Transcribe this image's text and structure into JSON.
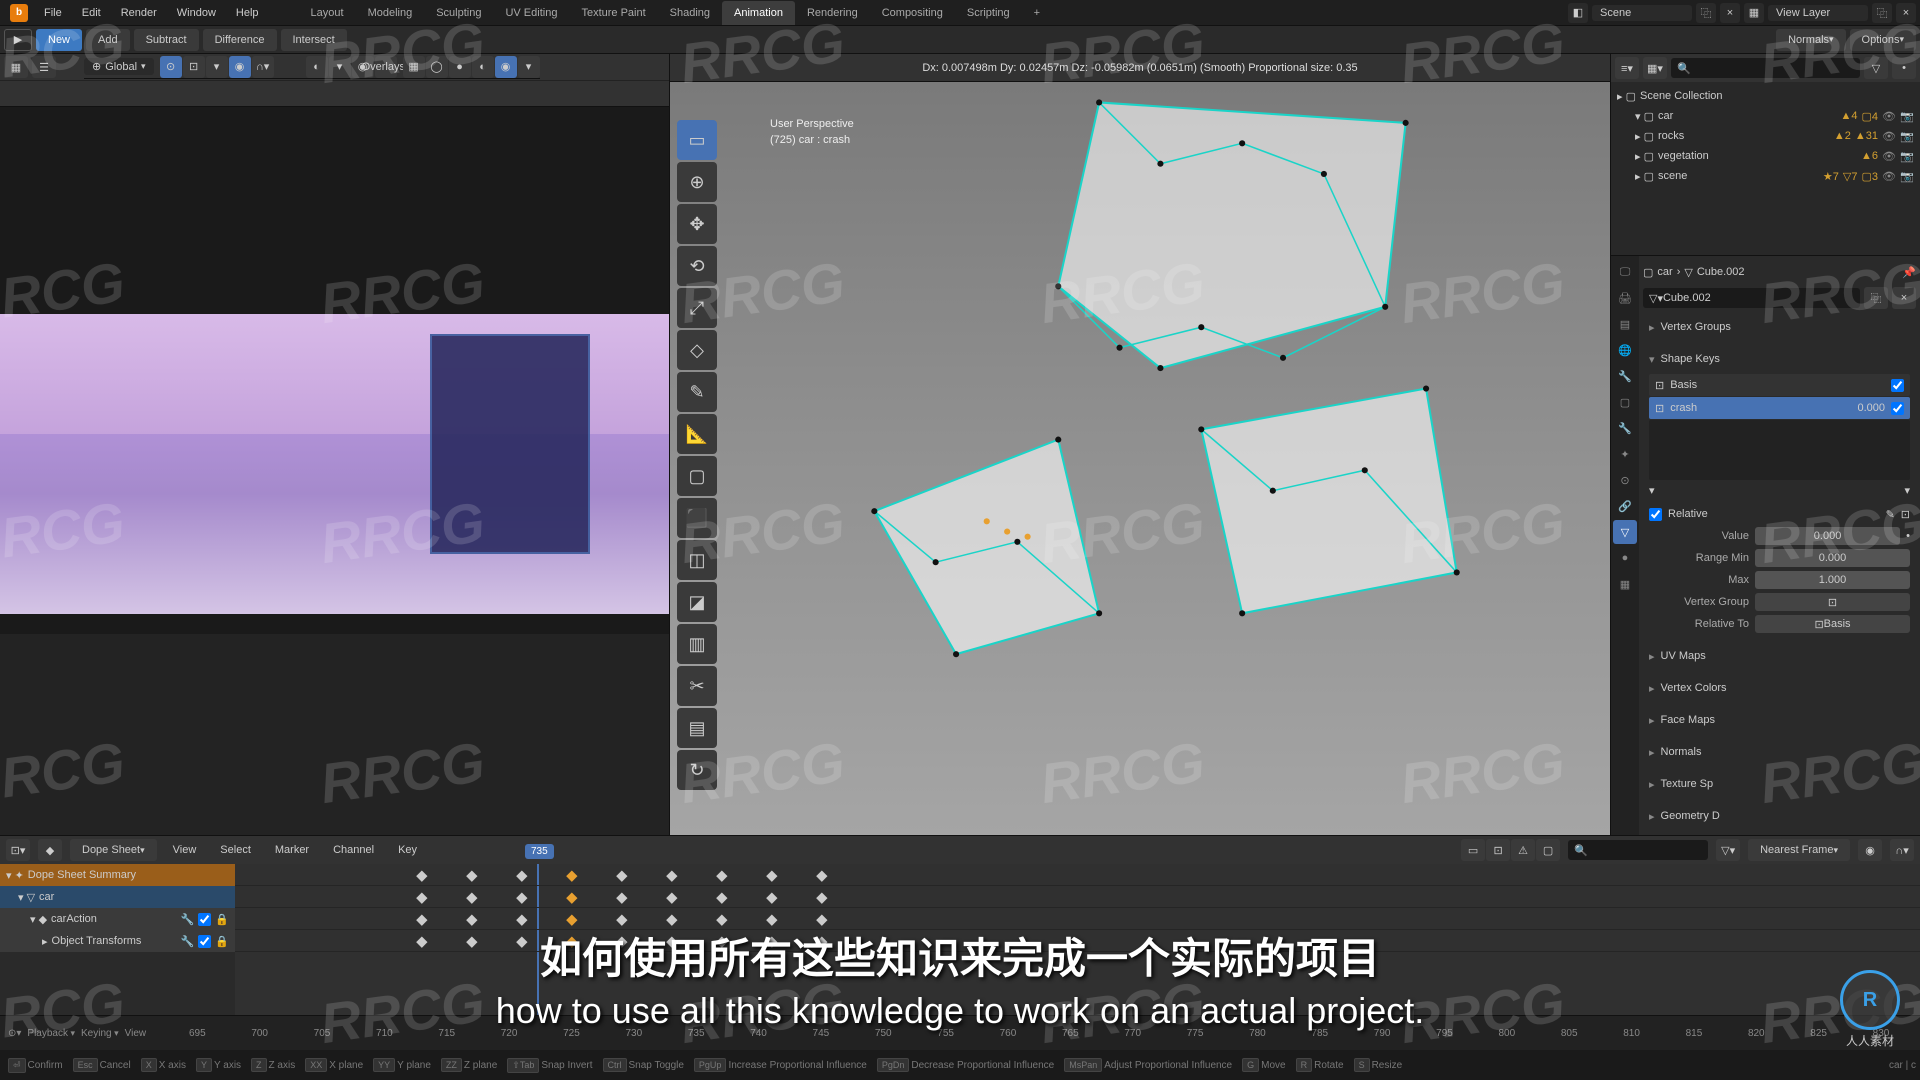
{
  "menubar": {
    "items": [
      "File",
      "Edit",
      "Render",
      "Window",
      "Help"
    ],
    "tabs": [
      "Layout",
      "Modeling",
      "Sculpting",
      "UV Editing",
      "Texture Paint",
      "Shading",
      "Animation",
      "Rendering",
      "Compositing",
      "Scripting"
    ],
    "active_tab": 6,
    "scene_label": "Scene",
    "viewlayer_label": "View Layer"
  },
  "headbar": {
    "buttons": [
      "New",
      "Add",
      "Subtract",
      "Difference",
      "Intersect"
    ],
    "right": [
      "Normals",
      "Options"
    ]
  },
  "viewport": {
    "orientation": "Global",
    "overlay_label": "Overlays",
    "status_line": "Dx: 0.007498m   Dy: 0.02457m   Dz: -0.05982m (0.0651m) (Smooth)   Proportional size: 0.35",
    "perspective": "User Perspective",
    "object": "(725) car : crash"
  },
  "outliner": {
    "root": "Scene Collection",
    "items": [
      {
        "name": "car",
        "badges": [
          "▲4",
          "▢4"
        ]
      },
      {
        "name": "rocks",
        "badges": [
          "▲2",
          "▲31"
        ]
      },
      {
        "name": "vegetation",
        "badges": [
          "▲6"
        ]
      },
      {
        "name": "scene",
        "badges": [
          "★7",
          "▽7",
          "▢3"
        ]
      }
    ]
  },
  "properties": {
    "object": "car",
    "data_name": "Cube.002",
    "sections": {
      "vertex_groups": "Vertex Groups",
      "shape_keys": "Shape Keys",
      "uv_maps": "UV Maps",
      "vertex_colors": "Vertex Colors",
      "face_maps": "Face Maps",
      "normals": "Normals",
      "texture_space": "Texture Sp",
      "geometry_data": "Geometry D"
    },
    "shape_keys_list": [
      {
        "name": "Basis",
        "value": ""
      },
      {
        "name": "crash",
        "value": "0.000"
      }
    ],
    "relative_checkbox": "Relative",
    "fields": {
      "value_label": "Value",
      "value": "0.000",
      "range_min_label": "Range Min",
      "range_min": "0.000",
      "max_label": "Max",
      "max": "1.000",
      "vertex_group_label": "Vertex Group",
      "relative_to_label": "Relative To",
      "relative_to": "Basis"
    }
  },
  "dopesheet": {
    "editor": "Dope Sheet",
    "menus": [
      "View",
      "Select",
      "Marker",
      "Channel",
      "Key"
    ],
    "snap_label": "Nearest Frame",
    "tree": [
      {
        "label": "Dope Sheet Summary",
        "cls": "orange"
      },
      {
        "label": "car",
        "cls": "blue"
      },
      {
        "label": "carAction",
        "cls": "gray"
      },
      {
        "label": "Object Transforms",
        "cls": "gray"
      }
    ],
    "key_frames": [
      720,
      725,
      730,
      735,
      740,
      745,
      750,
      755,
      760
    ],
    "highlight_col": 735
  },
  "timeline": {
    "playback": "Playback",
    "keying": "Keying",
    "view": "View",
    "current_frame": "735",
    "ticks": [
      "695",
      "700",
      "705",
      "710",
      "715",
      "720",
      "725",
      "730",
      "735",
      "740",
      "745",
      "750",
      "755",
      "760",
      "765",
      "770",
      "775",
      "780",
      "785",
      "790",
      "795",
      "800",
      "805",
      "810",
      "815",
      "820",
      "825",
      "830"
    ]
  },
  "footer": {
    "hints": [
      {
        "key": "⏎",
        "label": "Confirm"
      },
      {
        "key": "Esc",
        "label": "Cancel"
      },
      {
        "key": "X",
        "label": "X axis"
      },
      {
        "key": "Y",
        "label": "Y axis"
      },
      {
        "key": "Z",
        "label": "Z axis"
      },
      {
        "key": "XX",
        "label": "X plane"
      },
      {
        "key": "YY",
        "label": "Y plane"
      },
      {
        "key": "ZZ",
        "label": "Z plane"
      },
      {
        "key": "⇧Tab",
        "label": "Snap Invert"
      },
      {
        "key": "Ctrl",
        "label": "Snap Toggle"
      },
      {
        "key": "PgUp",
        "label": "Increase Proportional Influence"
      },
      {
        "key": "PgDn",
        "label": "Decrease Proportional Influence"
      },
      {
        "key": "MsPan",
        "label": "Adjust Proportional Influence"
      },
      {
        "key": "G",
        "label": "Move"
      },
      {
        "key": "R",
        "label": "Rotate"
      },
      {
        "key": "S",
        "label": "Resize"
      }
    ],
    "status_right": "car | c"
  },
  "subtitle": {
    "cn": "如何使用所有这些知识来完成一个实际的项目",
    "en": "how to use all this knowledge to work on an actual project."
  },
  "watermark": "RRCG",
  "logo_badge": {
    "initials": "R",
    "text": "人人素材"
  }
}
